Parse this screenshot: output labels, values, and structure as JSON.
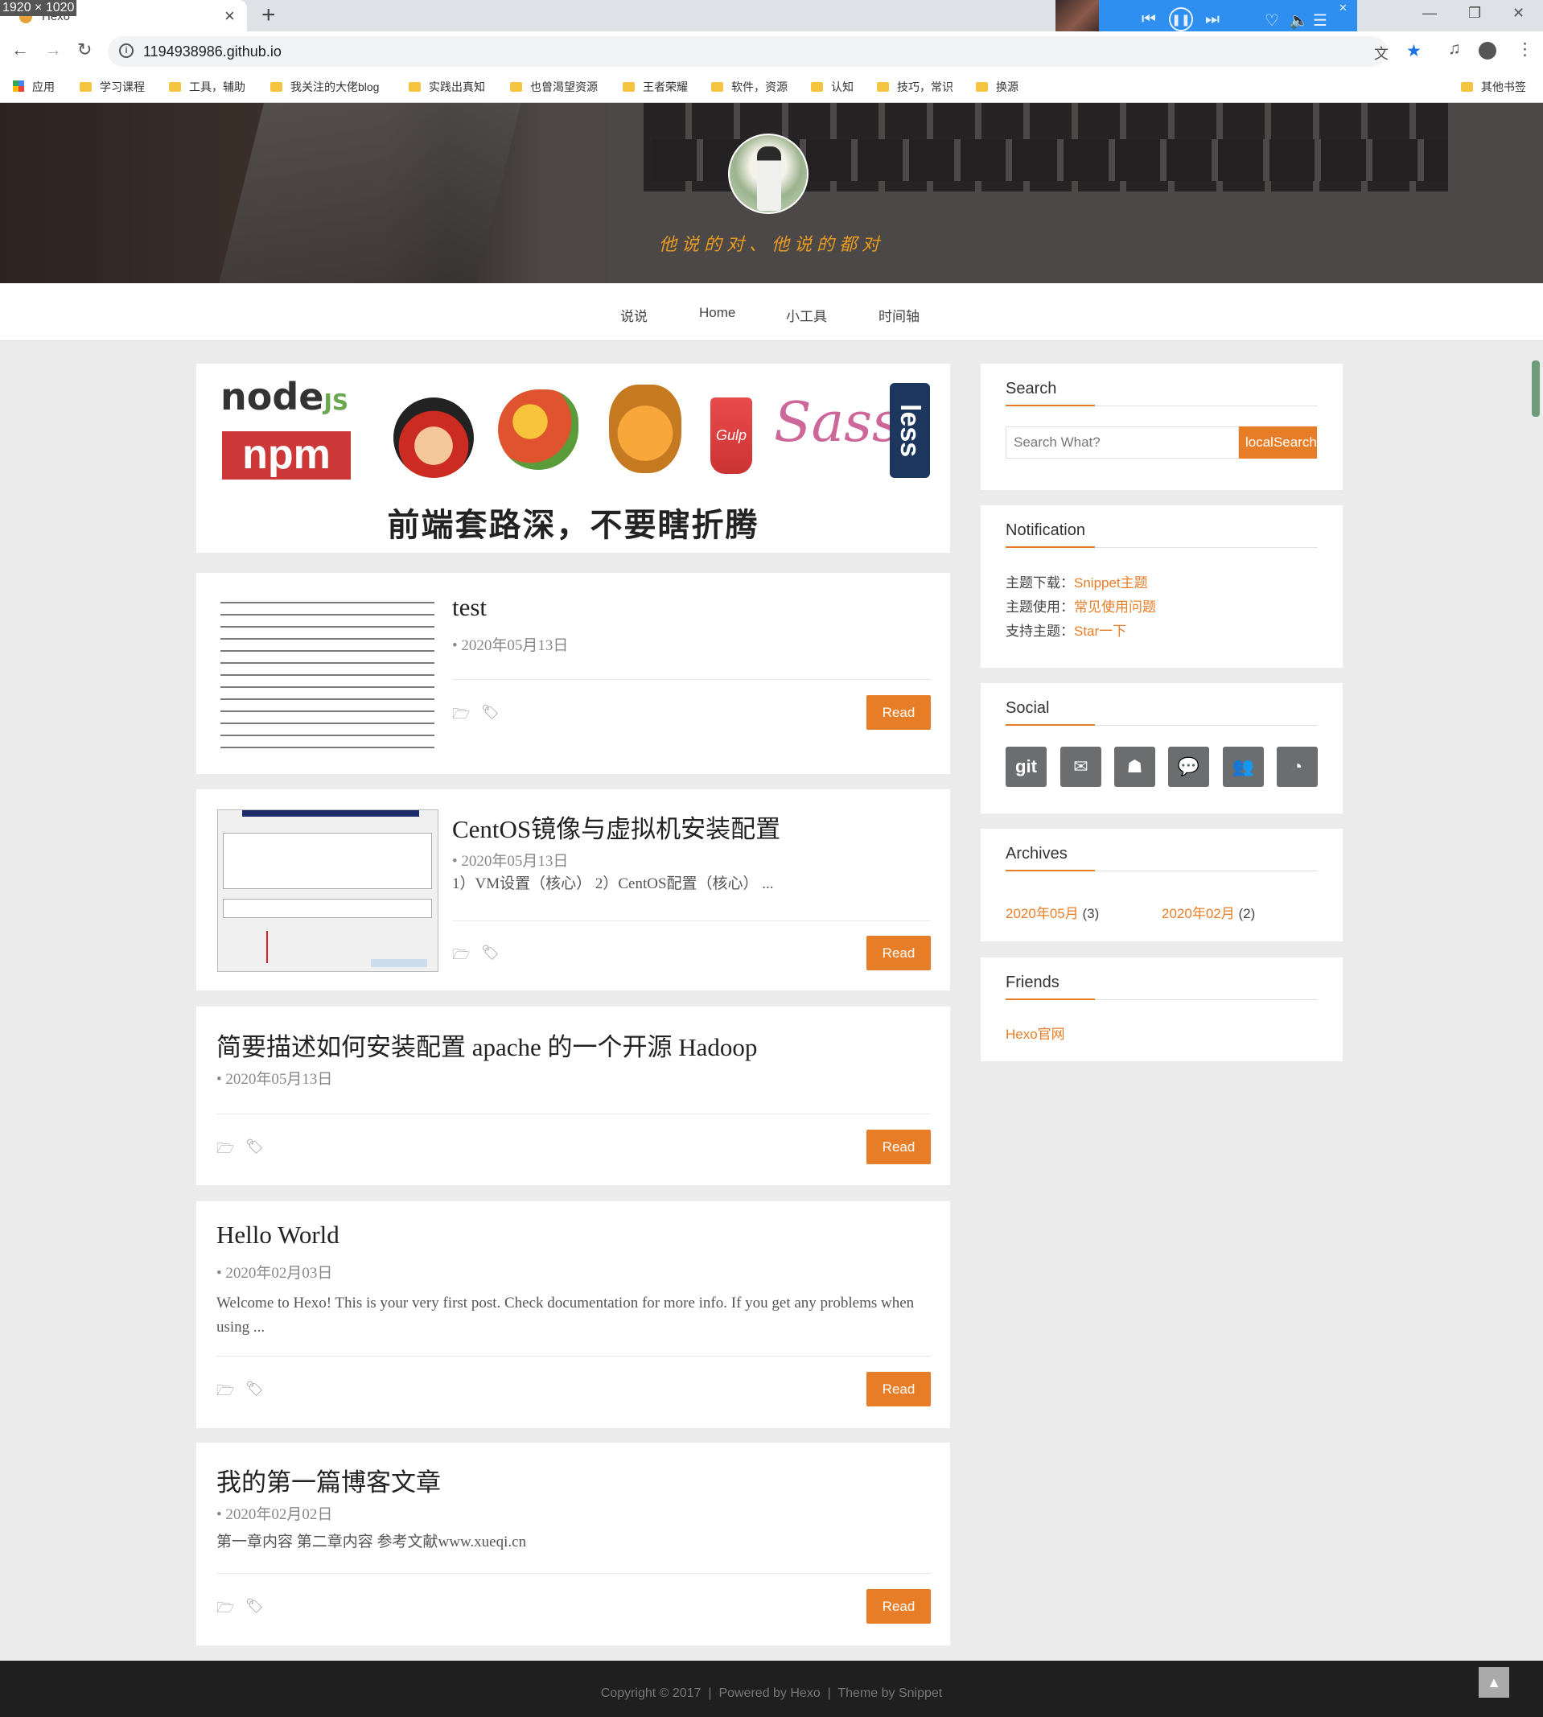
{
  "browser": {
    "dim_label": "1920 × 1020",
    "tab_title": "Hexo",
    "url": "1194938986.github.io",
    "bookmarks": [
      "应用",
      "学习课程",
      "工具，辅助",
      "我关注的大佬blog",
      "实践出真知",
      "也曾渴望资源",
      "王者荣耀",
      "软件，资源",
      "认知",
      "技巧，常识",
      "换源",
      "其他书签"
    ],
    "tab_close": "×",
    "new_tab": "+"
  },
  "hero": {
    "motto": "他说的对、他说的都对"
  },
  "nav": {
    "items": [
      "说说",
      "Home",
      "小工具",
      "时间轴"
    ]
  },
  "banner": {
    "caption": "前端套路深，不要瞎折腾",
    "logos": [
      "node",
      "npm",
      "yeoman",
      "bower",
      "grunt",
      "gulp",
      "sass",
      "less"
    ]
  },
  "posts": [
    {
      "title": "test",
      "date": "• 2020年05月13日",
      "desc": "",
      "read": "Read"
    },
    {
      "title": "CentOS镜像与虚拟机安装配置",
      "date": "• 2020年05月13日",
      "desc": "1）VM设置（核心） 2）CentOS配置（核心） ...",
      "read": "Read"
    },
    {
      "title": "简要描述如何安装配置 apache 的一个开源 Hadoop",
      "date": "• 2020年05月13日",
      "desc": "",
      "read": "Read"
    },
    {
      "title": "Hello World",
      "date": "• 2020年02月03日",
      "desc": "Welcome to Hexo! This is your very first post. Check documentation for more info. If you get any problems when using ...",
      "read": "Read"
    },
    {
      "title": "我的第一篇博客文章",
      "date": "• 2020年02月02日",
      "desc": "第一章内容 第二章内容 参考文献www.xueqi.cn",
      "read": "Read"
    }
  ],
  "sidebar": {
    "search": {
      "title": "Search",
      "placeholder": "Search What?",
      "button": "localSearch"
    },
    "notification": {
      "title": "Notification",
      "lines": [
        {
          "label": "主题下载：",
          "link": "Snippet主题"
        },
        {
          "label": "主题使用：",
          "link": "常见使用问题"
        },
        {
          "label": "支持主题：",
          "link": "Star一下"
        }
      ]
    },
    "social": {
      "title": "Social",
      "items": [
        "git-icon",
        "mail-icon",
        "qq-icon",
        "wechat-icon",
        "group-icon",
        "rss-icon"
      ],
      "git_label": "git"
    },
    "archives": {
      "title": "Archives",
      "items": [
        {
          "month": "2020年05月",
          "count": "(3)"
        },
        {
          "month": "2020年02月",
          "count": "(2)"
        }
      ]
    },
    "friends": {
      "title": "Friends",
      "link": "Hexo官网"
    }
  },
  "footer": {
    "text": "Copyright © 2017  |  Powered by Hexo  |  Theme by Snippet",
    "to_top": "▲"
  },
  "colors": {
    "accent": "#e87d27",
    "footer_bg": "#1f1f1f",
    "page_bg": "#ececec"
  }
}
